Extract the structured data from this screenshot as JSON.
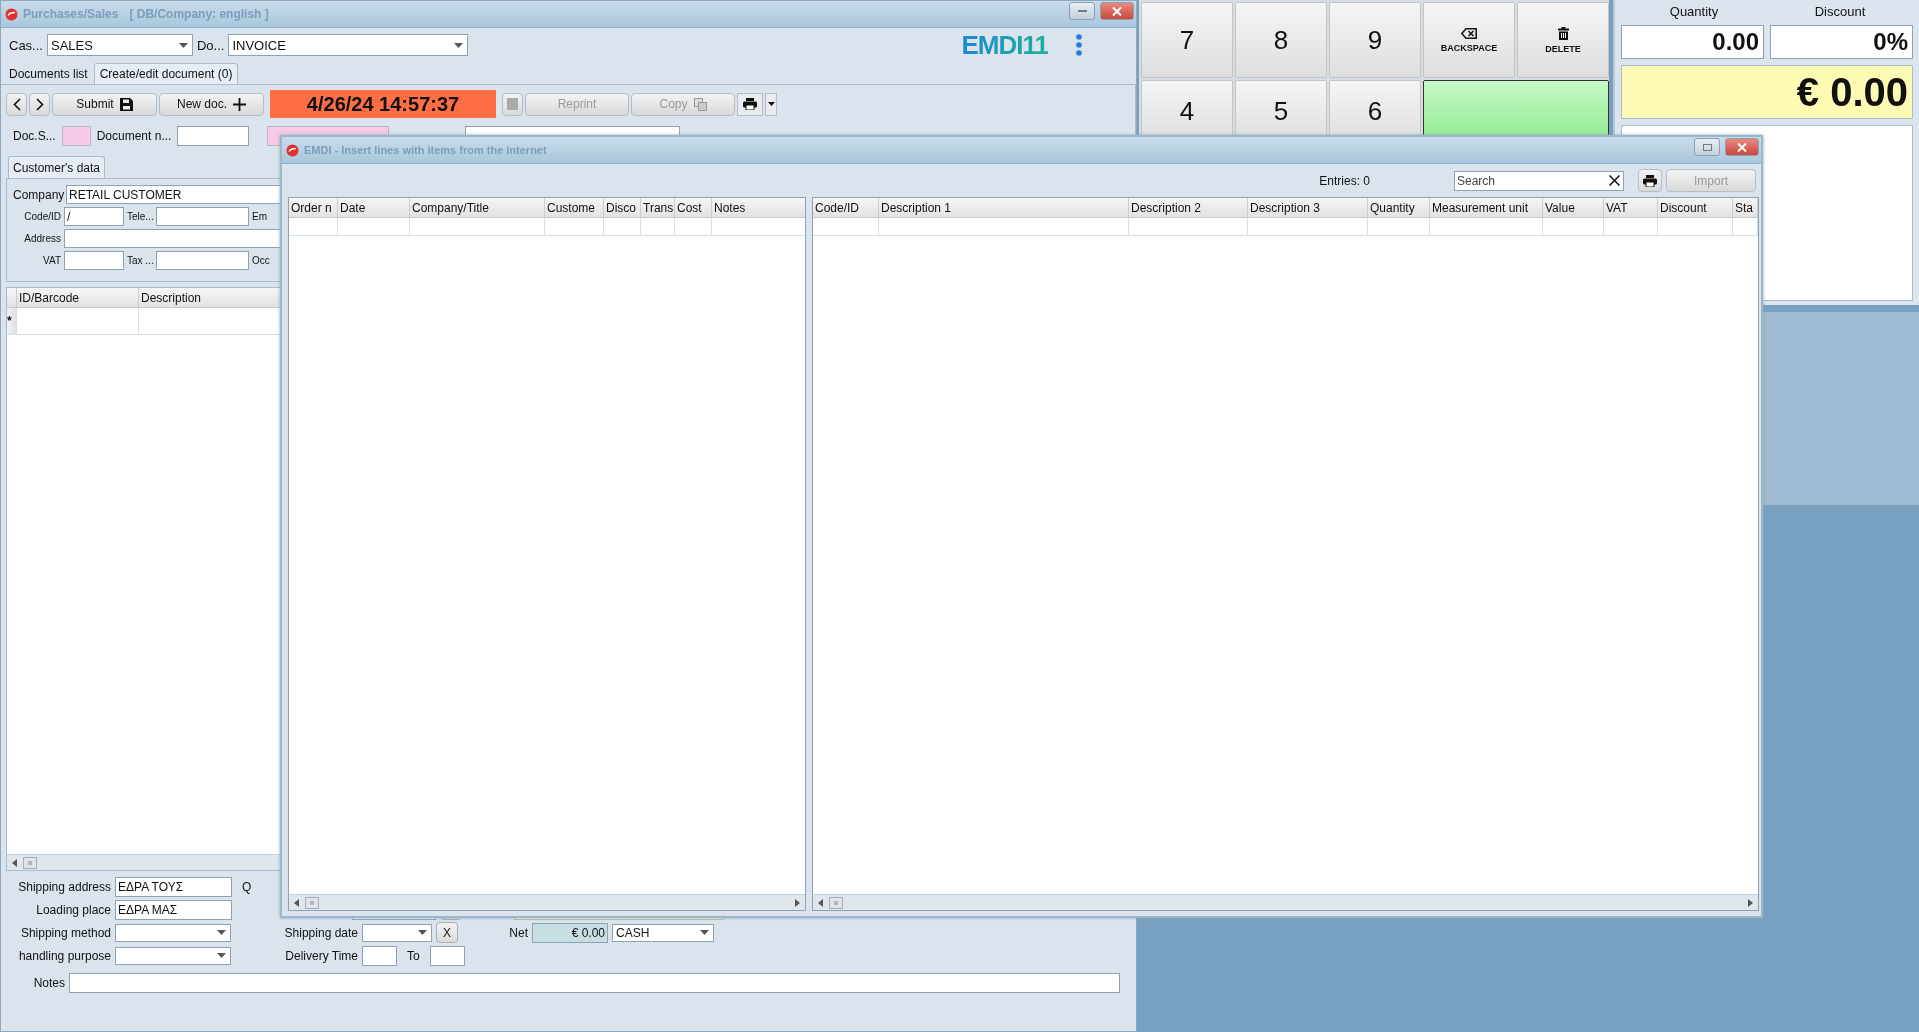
{
  "main_window": {
    "title": "Purchases/Sales",
    "subtitle": "[ DB/Company: english ]",
    "case_label": "Cas...",
    "case_value": "SALES",
    "doc_label": "Do...",
    "doc_value": "INVOICE",
    "logo": "EMDI11"
  },
  "tabs": [
    {
      "label": "Documents list",
      "selected": false
    },
    {
      "label": "Create/edit document (0)",
      "selected": true
    }
  ],
  "toolbar": {
    "submit": "Submit",
    "new_doc": "New doc.",
    "datetime": "4/26/24 14:57:37",
    "reprint": {
      "label": "Reprint",
      "disabled": true
    },
    "copy": {
      "label": "Copy",
      "disabled": true
    }
  },
  "doc_row": {
    "status_label": "Doc.S...",
    "number_label": "Document n..."
  },
  "customer": {
    "tab": "Customer's data",
    "company_label": "Company",
    "company_value": "RETAIL CUSTOMER",
    "code_label": "Code/ID",
    "code_value": "/",
    "phone_label": "Tele...",
    "email_label": "Em",
    "address_label": "Address",
    "vat_label": "VAT",
    "tax_label": "Tax ...",
    "occupation_label": "Occ"
  },
  "lines_grid": {
    "columns": [
      "ID/Barcode",
      "Description"
    ],
    "new_row_marker": "*"
  },
  "shipping": {
    "address_label": "Shipping address",
    "address_value": "ΕΔΡΑ ΤΟΥΣ",
    "q_label": "Q",
    "loading_label": "Loading place",
    "loading_value": "ΕΔΡΑ ΜΑΣ",
    "method_label": "Shipping method",
    "purpose_label": "handling purpose",
    "date_label": "Shipping date",
    "clear": "X",
    "delivery_label": "Delivery Time",
    "to_label": "To",
    "net_label": "Net",
    "net_value": "€ 0.00",
    "payment": "CASH",
    "notes_label": "Notes"
  },
  "keypad": [
    {
      "label": "7",
      "kind": "digit"
    },
    {
      "label": "8",
      "kind": "digit"
    },
    {
      "label": "9",
      "kind": "digit"
    },
    {
      "label": "BACKSPACE",
      "kind": "backspace"
    },
    {
      "label": "DELETE",
      "kind": "delete"
    },
    {
      "label": "4",
      "kind": "digit"
    },
    {
      "label": "5",
      "kind": "digit"
    },
    {
      "label": "6",
      "kind": "digit"
    },
    {
      "kind": "enter"
    }
  ],
  "totals": {
    "quantity_label": "Quantity",
    "quantity": "0.00",
    "discount_label": "Discount",
    "discount": "0%",
    "total": "€ 0.00"
  },
  "popup": {
    "title": "EMDI - Insert lines with items from the internet",
    "entries": "Entries: 0",
    "search_placeholder": "Search",
    "import": {
      "label": "Import",
      "disabled": true
    },
    "orders_table": {
      "columns": [
        "Order n",
        "Date",
        "Company/Title",
        "Custome",
        "Disco",
        "Trans",
        "Cost",
        "Notes"
      ]
    },
    "items_table": {
      "columns": [
        "Code/ID",
        "Description 1",
        "Description 2",
        "Description 3",
        "Quantity",
        "Measurement unit",
        "Value",
        "VAT",
        "Discount",
        "Sta"
      ]
    }
  }
}
